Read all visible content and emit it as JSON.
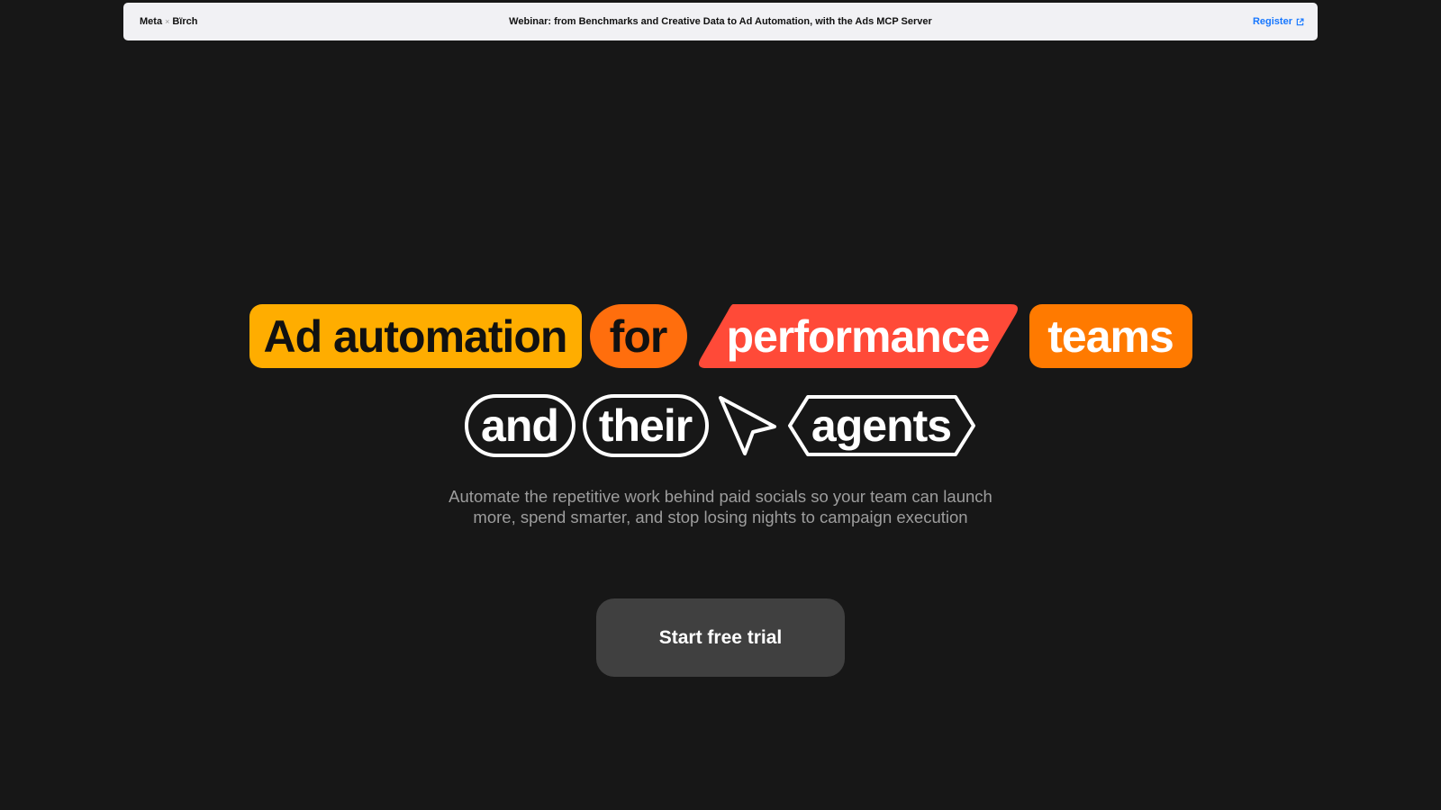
{
  "banner": {
    "brand_primary": "Meta",
    "brand_separator": "×",
    "brand_secondary": "Bïrch",
    "title": "Webinar: from Benchmarks and Creative Data to Ad Automation, with the Ads MCP Server",
    "register_label": "Register",
    "register_icon": "external-link-icon",
    "register_color": "#1677ff"
  },
  "headline": {
    "row1": [
      "Ad automation",
      "for",
      "performance",
      "teams"
    ],
    "row2": [
      "and",
      "their",
      "agents"
    ],
    "cursor_icon": "cursor-arrow-icon",
    "colors": {
      "ad_automation": "#ffad00",
      "for": "#ff6e0d",
      "performance": "#ff4a38",
      "teams": "#ff7a00",
      "outline": "#ffffff"
    }
  },
  "subtitle": {
    "line1": "Automate the repetitive work behind paid socials so your team can launch",
    "line2": "more, spend smarter, and stop losing nights to campaign execution"
  },
  "cta": {
    "label": "Start free trial"
  },
  "theme": {
    "background": "#171717",
    "banner_background": "#f1f1f4",
    "cta_background": "#404040",
    "subtitle_color": "#9d9d9d"
  }
}
